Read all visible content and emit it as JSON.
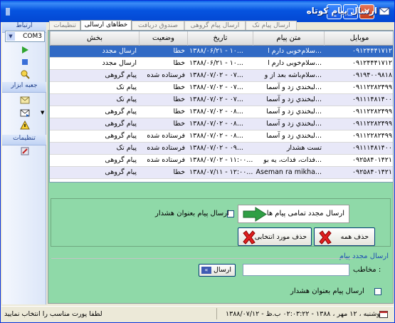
{
  "window": {
    "title": "ارسال پیام کوتاه",
    "left_mark": "|||",
    "buttons": {
      "minimize": "_",
      "maximize": "□",
      "close": "✕"
    }
  },
  "sidebar": {
    "connection_header": "ارتباط",
    "port_value": "COM3",
    "toolbox_header": "جعبه ابزار",
    "settings_header": "تنظیمات",
    "icons": [
      "play-icon",
      "stop-icon",
      "search-icon",
      "inbox-icon",
      "send-mail-icon",
      "warning-icon",
      "settings-icon"
    ]
  },
  "tabs": [
    {
      "label": "ارسال پیام تک",
      "active": false
    },
    {
      "label": "ارسال پیام گروهی",
      "active": false
    },
    {
      "label": "صندوق دریافت",
      "active": false
    },
    {
      "label": "خطاهای ارسالی",
      "active": true
    },
    {
      "label": "تنظیمات",
      "active": false
    }
  ],
  "grid": {
    "columns": [
      "موبایل",
      "متن پیام",
      "تاریخ",
      "وضعیت",
      "بخش"
    ],
    "rows": [
      {
        "mobile": "۰۹۱۲۴۴۴۱۷۱۲",
        "message": "سلام‌خوبی دارم ا...",
        "date": "۱۳۸۸/۰۶/۲۱ - ۱۰...",
        "status": "خطا",
        "section": "ارسال مجدد",
        "selected": true
      },
      {
        "mobile": "۰۹۱۲۴۴۴۱۷۱۲",
        "message": "سلام‌خوبی دارم ا...",
        "date": "۱۳۸۸/۰۶/۲۱ - ۱۰...",
        "status": "خطا",
        "section": "ارسال مجدد"
      },
      {
        "mobile": "۰۹۱۹۴۰۰۹۸۱۸",
        "message": "سلام‌باشه بعد از و...",
        "date": "۱۳۸۸/۰۷/۰۲ - ۰۷...",
        "status": "فرستاده شده",
        "section": "پیام گروهی"
      },
      {
        "mobile": "۰۹۱۱۲۲۸۲۴۹۹",
        "message": "لبخندي زد و آسما...",
        "date": "۱۳۸۸/۰۷/۰۲ - ۰۷...",
        "status": "خطا",
        "section": "پیام تک"
      },
      {
        "mobile": "۰۹۱۱۱۴۸۱۴۰۰",
        "message": "لبخندي زد و آسما...",
        "date": "۱۳۸۸/۰۷/۰۲ - ۰۷...",
        "status": "خطا",
        "section": "پیام تک"
      },
      {
        "mobile": "۰۹۱۱۲۲۸۲۴۹۹",
        "message": "لبخندي زد و آسما...",
        "date": "۱۳۸۸/۰۷/۰۲ - ۰۸...",
        "status": "خطا",
        "section": "پیام گروهی"
      },
      {
        "mobile": "۰۹۱۱۲۲۸۲۴۹۹",
        "message": "لبخندي زد و آسما...",
        "date": "۱۳۸۸/۰۷/۰۲ - ۰۸...",
        "status": "خطا",
        "section": "پیام گروهی"
      },
      {
        "mobile": "۰۹۱۱۲۲۸۲۴۹۹",
        "message": "لبخندي زد و آسما...",
        "date": "۱۳۸۸/۰۷/۰۲ - ۰۸...",
        "status": "فرستاده شده",
        "section": "پیام گروهی"
      },
      {
        "mobile": "۰۹۱۱۱۴۸۱۴۰۰",
        "message": "تست هشدار",
        "date": "۱۳۸۸/۰۷/۰۲ - ۰۹...",
        "status": "فرستاده شده",
        "section": "پیام تک"
      },
      {
        "mobile": "۰۹۲۵۸۴۰۱۴۲۱",
        "message": "فدات، فدات، یه بو...",
        "date": "۱۳۸۸/۰۷/۰۲ - ۱۱:۰۰...",
        "status": "فرستاده شده",
        "section": "پیام گروهی"
      },
      {
        "mobile": "۰۹۲۵۸۴۰۱۴۲۱",
        "message": "Aseman ra mikha...",
        "date": "۱۳۸۸/۰۷/۱۱ - ۱۲:۰۰...",
        "status": "خطا",
        "section": "پیام گروهی"
      }
    ]
  },
  "actions": {
    "resend_all_label": "ارسال مجدد تمامی پیام ها",
    "as_warning_label": "ارسال پیام بعنوان هشدار",
    "delete_all_label": "حذف همه",
    "delete_selected_label": "حذف مورد انتخابی"
  },
  "resend_section": {
    "title": "ارسال مجدد پیام",
    "recipient_label": "مخاطب :",
    "recipient_value": "",
    "send_label": "ارسال",
    "send_glyph": "«",
    "warning_label": "ارسال پیام بعنوان هشدار"
  },
  "statusbar": {
    "left_text": "لطفا پورت مناسب را انتخاب نمایید",
    "right_text": "۱۳۸۸/۰۷/۱۲ - دوشنبه ، ۱۲ مهر ، ۱۳۸۸ - ۰۲:۰۳:۲۲ ب.ظ"
  },
  "colors": {
    "title_bar": "#0654E0",
    "panel_bg": "#8FD9A8",
    "selected_row": "#316AC5",
    "alt_row": "#E8E8F8",
    "section_title": "#1F4FB3"
  }
}
